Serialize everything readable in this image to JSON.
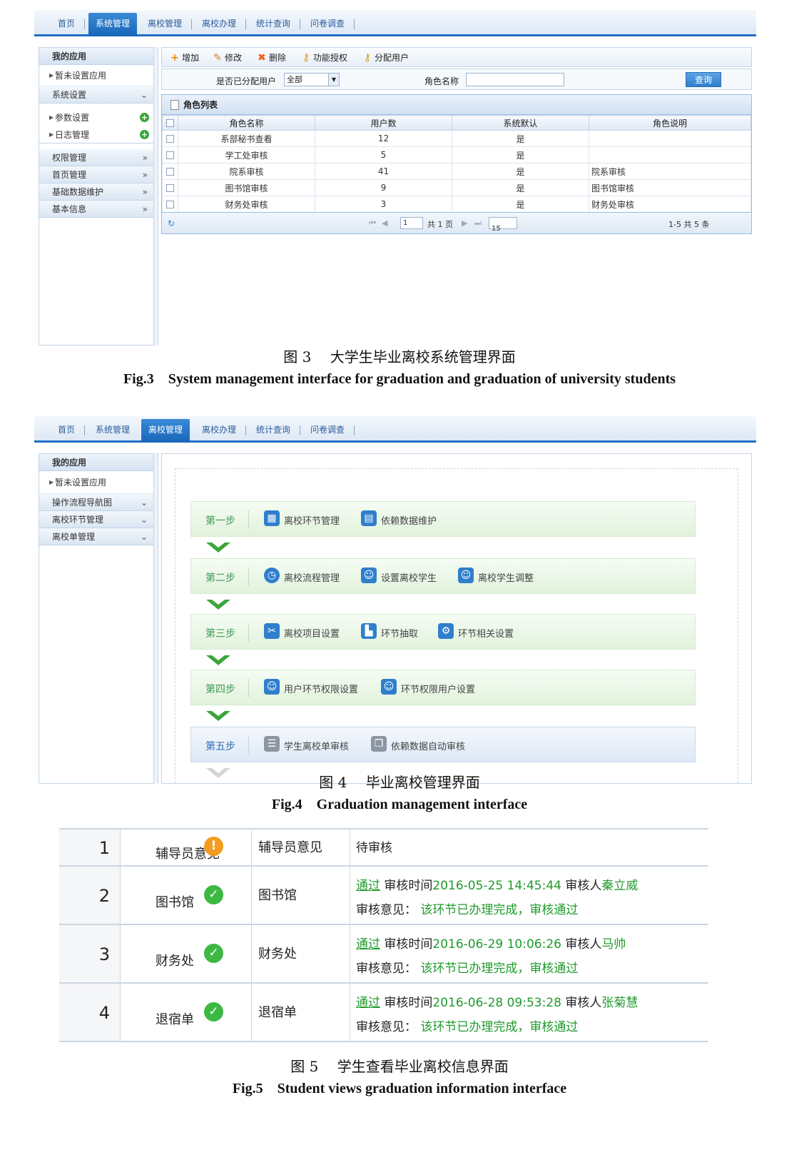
{
  "fig3": {
    "nav": [
      "首页",
      "系统管理",
      "离校管理",
      "离校办理",
      "统计查询",
      "问卷调查"
    ],
    "nav_active": 1,
    "sidebar": {
      "head": "我的应用",
      "item": "暂未设置应用",
      "group1": "系统设置",
      "sub": [
        "参数设置",
        "日志管理"
      ],
      "groups": [
        "权限管理",
        "首页管理",
        "基础数据维护",
        "基本信息"
      ]
    },
    "toolbar": {
      "add": "增加",
      "edit": "修改",
      "delete": "删除",
      "grant": "功能授权",
      "assign": "分配用户"
    },
    "search": {
      "assigned_label": "是否已分配用户",
      "assigned_value": "全部",
      "role_label": "角色名称",
      "query": "查询"
    },
    "grid_title": "角色列表",
    "columns": [
      "角色名称",
      "用户数",
      "系统默认",
      "角色说明"
    ],
    "rows": [
      [
        "系部秘书查看",
        "12",
        "是",
        ""
      ],
      [
        "学工处审核",
        "5",
        "是",
        ""
      ],
      [
        "院系审核",
        "41",
        "是",
        "院系审核"
      ],
      [
        "图书馆审核",
        "9",
        "是",
        "图书馆审核"
      ],
      [
        "财务处审核",
        "3",
        "是",
        "财务处审核"
      ]
    ],
    "pager": {
      "page": "1",
      "total_pages": "共 1 页",
      "size": "15",
      "range": "1-5  共 5 条"
    },
    "caption_cn": "图 3　 大学生毕业离校系统管理界面",
    "caption_en": "Fig.3　System management interface for graduation and graduation of university students"
  },
  "fig4": {
    "nav": [
      "首页",
      "系统管理",
      "离校管理",
      "离校办理",
      "统计查询",
      "问卷调查"
    ],
    "nav_active": 2,
    "sidebar": {
      "head": "我的应用",
      "item": "暂未设置应用",
      "groups": [
        "操作流程导航图",
        "离校环节管理",
        "离校单管理"
      ]
    },
    "steps": [
      {
        "label": "第一步",
        "items": [
          "离校环节管理",
          "依赖数据维护"
        ]
      },
      {
        "label": "第二步",
        "items": [
          "离校流程管理",
          "设置离校学生",
          "离校学生调整"
        ]
      },
      {
        "label": "第三步",
        "items": [
          "离校项目设置",
          "环节抽取",
          "环节相关设置"
        ]
      },
      {
        "label": "第四步",
        "items": [
          "用户环节权限设置",
          "环节权限用户设置"
        ]
      },
      {
        "label": "第五步",
        "items": [
          "学生离校单审核",
          "依赖数据自动审核"
        ]
      }
    ],
    "caption_cn": "图 4　 毕业离校管理界面",
    "caption_en": "Fig.4　Graduation management interface"
  },
  "fig5": {
    "rows": [
      {
        "num": "1",
        "name": "辅导员意见",
        "status": "warning",
        "dept": "辅导员意见",
        "info": "待审核"
      },
      {
        "num": "2",
        "name": "图书馆",
        "status": "ok",
        "dept": "图书馆",
        "pass": "通过",
        "time_label": "审核时间",
        "time": "2016-05-25 14:45:44",
        "auditor_label": "审核人",
        "auditor": "秦立威",
        "opinion_label": "审核意见：",
        "opinion": "该环节已办理完成，审核通过"
      },
      {
        "num": "3",
        "name": "财务处",
        "status": "ok",
        "dept": "财务处",
        "pass": "通过",
        "time_label": "审核时间",
        "time": "2016-06-29 10:06:26",
        "auditor_label": "审核人",
        "auditor": "马帅",
        "opinion_label": "审核意见：",
        "opinion": "该环节已办理完成，审核通过"
      },
      {
        "num": "4",
        "name": "退宿单",
        "status": "ok",
        "dept": "退宿单",
        "pass": "通过",
        "time_label": "审核时间",
        "time": "2016-06-28 09:53:28",
        "auditor_label": "审核人",
        "auditor": "张菊慧",
        "opinion_label": "审核意见：",
        "opinion": "该环节已办理完成，审核通过"
      }
    ],
    "caption_cn": "图 5　 学生查看毕业离校信息界面",
    "caption_en": "Fig.5　Student views graduation information interface"
  },
  "colors": {
    "nav_active": "#1866b8",
    "step_green": "#3e9a54",
    "arrow": "#3aa63a",
    "pass_text": "#1f9a2c",
    "warning": "#f39c1f",
    "ok": "#3db843"
  }
}
